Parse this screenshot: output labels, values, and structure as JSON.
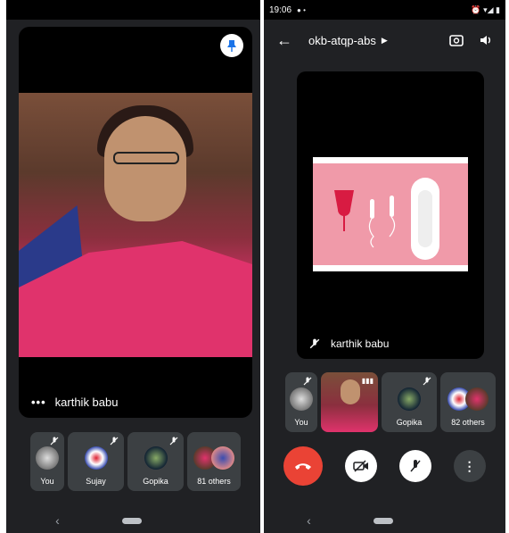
{
  "left": {
    "main_speaker": "karthik babu",
    "more_icon": "more-dots-icon",
    "participants": [
      {
        "name": "You",
        "muted": true
      },
      {
        "name": "Sujay",
        "muted": true
      },
      {
        "name": "Gopika",
        "muted": true
      },
      {
        "name": "81 others",
        "muted": false
      }
    ],
    "colors": {
      "background": "#202124",
      "tile": "#3c4043"
    }
  },
  "right": {
    "status": {
      "time": "19:06"
    },
    "meeting_code": "okb-atqp-abs",
    "presenter": "karthik babu",
    "participants": [
      {
        "name": "You",
        "muted": true
      },
      {
        "name": "",
        "muted": false
      },
      {
        "name": "Gopika",
        "muted": true
      },
      {
        "name": "82 others",
        "muted": false
      }
    ],
    "colors": {
      "end_call": "#ea4335"
    }
  }
}
